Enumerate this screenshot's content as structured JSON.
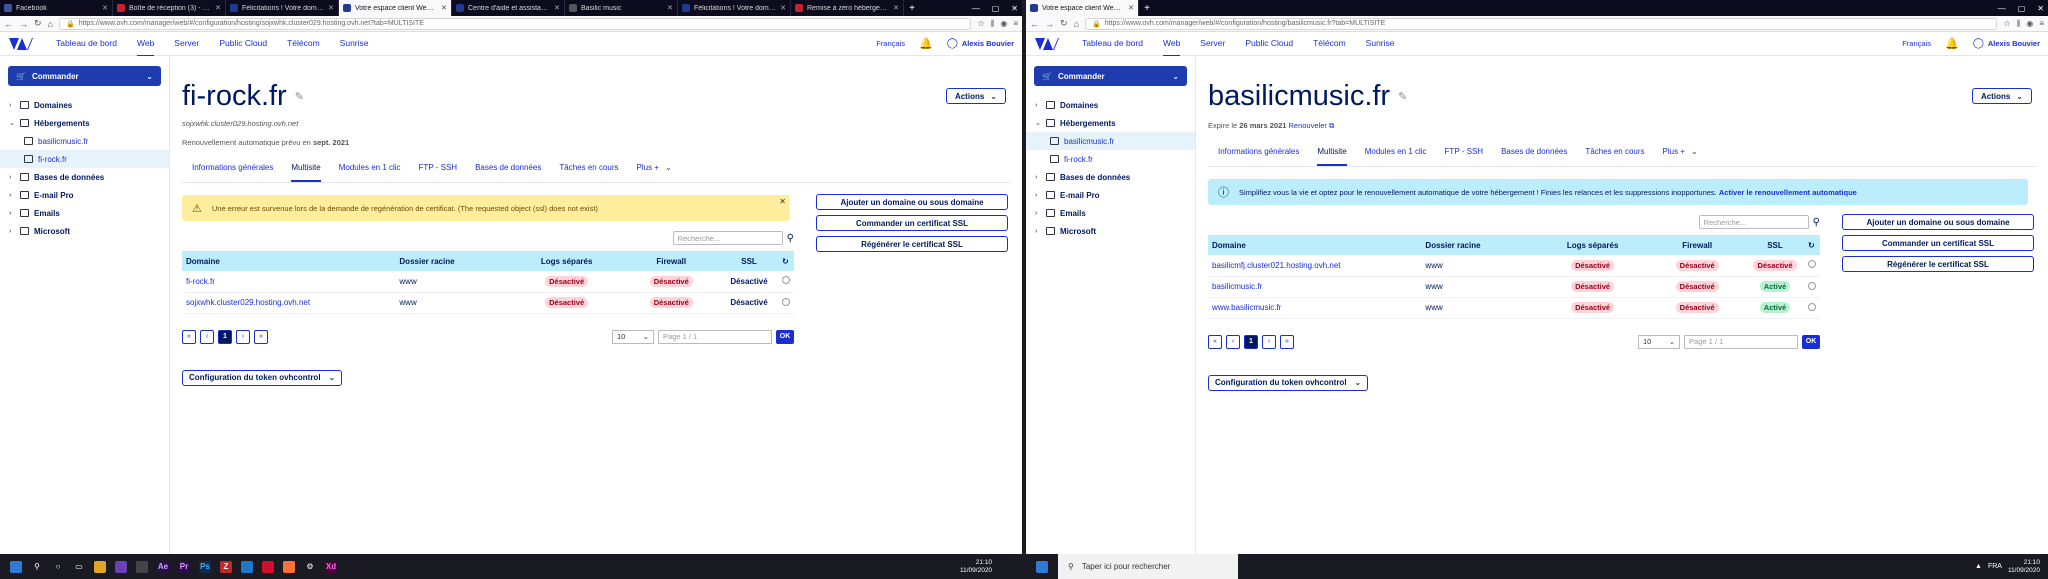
{
  "left": {
    "tabs": [
      {
        "title": "Facebook",
        "color": "#3b5998"
      },
      {
        "title": "Boîte de réception (3) - davi",
        "color": "#c6222a"
      },
      {
        "title": "Félicitations ! Votre domaine",
        "color": "#223a8f"
      },
      {
        "title": "Votre espace client Web OVH",
        "color": "#223a8f",
        "active": true
      },
      {
        "title": "Centre d'aide et assistance",
        "color": "#223a8f"
      },
      {
        "title": "Basilic music",
        "color": "#555555"
      },
      {
        "title": "Félicitations ! Votre domaine",
        "color": "#223a8f"
      },
      {
        "title": "Remise à zéro hébergement",
        "color": "#c6222a"
      }
    ],
    "url": "https://www.ovh.com/manager/web/#/configuration/hosting/sojxwhk.cluster029.hosting.ovh.net?tab=MULTISITE",
    "title": "fi-rock.fr",
    "hostname": "sojxwhk.cluster029.hosting.ovh.net",
    "renewal_prefix": "Renouvellement automatique prévu en",
    "renewal_date": "sept. 2021",
    "sidebar": {
      "sub_items": [
        "basilicmusic.fr",
        "fi-rock.fr"
      ],
      "selected": 1
    },
    "alert_text": "Une erreur est survenue lors de la demande de regénération de certificat. (The requested object (ssl) does not exist)",
    "rows": [
      {
        "domain": "fi-rock.fr",
        "root": "www",
        "logs": "Désactivé",
        "firewall": "Désactivé",
        "ssl": "Désactivé",
        "ssl_style": "plain"
      },
      {
        "domain": "sojxwhk.cluster029.hosting.ovh.net",
        "root": "www",
        "logs": "Désactivé",
        "firewall": "Désactivé",
        "ssl": "Désactivé",
        "ssl_style": "plain"
      }
    ],
    "tokbtn": "Configuration du token ovhcontrol"
  },
  "right": {
    "tabs": [
      {
        "title": "Votre espace client Web OVH",
        "color": "#223a8f",
        "active": true
      }
    ],
    "url": "https://www.ovh.com/manager/web/#/configuration/hosting/basilicmusic.fr?tab=MULTISITE",
    "title": "basilicmusic.fr",
    "expiry_prefix": "Expire le",
    "expiry_date": "26 mars 2021",
    "renew_link": "Renouveler",
    "sidebar": {
      "sub_items": [
        "basilicmusic.fr",
        "fi-rock.fr"
      ],
      "selected": 0
    },
    "info_text": "Simplifiez vous la vie et optez pour le renouvellement automatique de votre hébergement ! Finies les relances et les suppressions inopportunes.",
    "info_link": "Activer le renouvellement automatique",
    "rows": [
      {
        "domain": "basilicmfj.cluster021.hosting.ovh.net",
        "root": "www",
        "logs": "Désactivé",
        "firewall": "Désactivé",
        "ssl": "Désactivé",
        "ssl_style": "off"
      },
      {
        "domain": "basilicmusic.fr",
        "root": "www",
        "logs": "Désactivé",
        "firewall": "Désactivé",
        "ssl": "Activé",
        "ssl_style": "on"
      },
      {
        "domain": "www.basilicmusic.fr",
        "root": "www",
        "logs": "Désactivé",
        "firewall": "Désactivé",
        "ssl": "Activé",
        "ssl_style": "on"
      }
    ],
    "tokbtn": "Configuration du token ovhcontrol"
  },
  "common": {
    "menu": [
      "Tableau de bord",
      "Web",
      "Server",
      "Public Cloud",
      "Télécom",
      "Sunrise"
    ],
    "menu_selected": 1,
    "lang": "Français",
    "user": "Alexis Bouvier",
    "commander": "Commander",
    "sidebar_sections": [
      "Domaines",
      "Hébergements",
      "Bases de données",
      "E-mail Pro",
      "Emails",
      "Microsoft"
    ],
    "actions": "Actions",
    "page_tabs": [
      "Informations générales",
      "Multisite",
      "Modules en 1 clic",
      "FTP - SSH",
      "Bases de données",
      "Tâches en cours",
      "Plus +"
    ],
    "page_tab_selected": 1,
    "side_buttons": [
      "Ajouter un domaine ou sous domaine",
      "Commander un certificat SSL",
      "Régénérer le certificat SSL"
    ],
    "search_placeholder": "Recherche...",
    "col_headers": [
      "Domaine",
      "Dossier racine",
      "Logs séparés",
      "Firewall",
      "SSL"
    ],
    "pages": [
      "«",
      "‹",
      "1",
      "›",
      "»"
    ],
    "per_page": "10",
    "page_label": "Page 1 / 1",
    "ok": "OK"
  },
  "taskbar": {
    "search": "Taper ici pour rechercher",
    "time": "21:10",
    "date": "11/09/2020",
    "lang": "FRA"
  }
}
